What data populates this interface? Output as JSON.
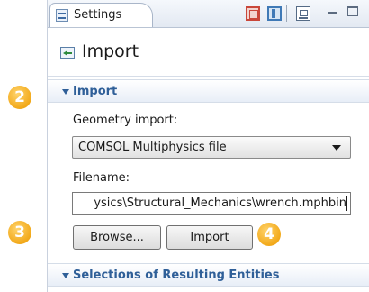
{
  "tab": {
    "label": "Settings",
    "icon": "settings-grid-icon"
  },
  "toolbar": {
    "icons": [
      "red-window-icon",
      "blue-pane-icon",
      "chart-window-icon"
    ],
    "window_controls": [
      "minimize-icon",
      "maximize-icon"
    ]
  },
  "page": {
    "title": "Import",
    "icon": "import-arrow-icon"
  },
  "import_section": {
    "title": "Import",
    "geometry_import_label": "Geometry import:",
    "geometry_import_value": "COMSOL Multiphysics file",
    "filename_label": "Filename:",
    "filename_value": "ysics\\Structural_Mechanics\\wrench.mphbin",
    "browse_label": "Browse...",
    "import_label": "Import"
  },
  "selections_section": {
    "title": "Selections of Resulting Entities"
  },
  "callouts": [
    "2",
    "3",
    "4"
  ],
  "colors": {
    "accent": "#2f5f98",
    "callout": "#f2a91a"
  }
}
